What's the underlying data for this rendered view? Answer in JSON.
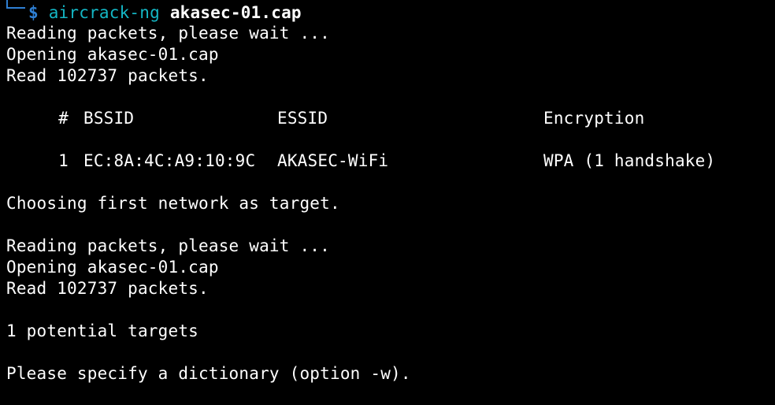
{
  "prompt": {
    "symbol": "$",
    "command": "aircrack-ng",
    "argument": "akasec-01.cap"
  },
  "block1": {
    "reading": "Reading packets, please wait ...",
    "opening": "Opening akasec-01.cap",
    "read": "Read 102737 packets."
  },
  "table": {
    "headers": {
      "num": "#",
      "bssid": "BSSID",
      "essid": "ESSID",
      "encryption": "Encryption"
    },
    "rows": [
      {
        "num": "1",
        "bssid": "EC:8A:4C:A9:10:9C",
        "essid": "AKASEC-WiFi",
        "encryption": "WPA (1 handshake)"
      }
    ]
  },
  "choosing": "Choosing first network as target.",
  "block2": {
    "reading": "Reading packets, please wait ...",
    "opening": "Opening akasec-01.cap",
    "read": "Read 102737 packets."
  },
  "targets": "1 potential targets",
  "dictionary_msg": "Please specify a dictionary (option -w).",
  "colors": {
    "background": "#000000",
    "text": "#ffffff",
    "prompt_frame": "#2e7fd3",
    "command": "#14b6c4"
  }
}
